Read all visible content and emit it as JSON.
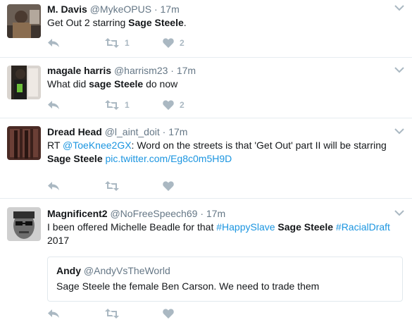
{
  "tweets": [
    {
      "name": "M. Davis",
      "handle": "@MykeOPUS",
      "separator": "·",
      "time": "17m",
      "text_1": "Get Out 2 starring ",
      "text_bold_1": "Sage Steele",
      "text_2": ".",
      "retweets": "1",
      "likes": "2"
    },
    {
      "name": "magale harris",
      "handle": "@harrism23",
      "separator": "·",
      "time": "17m",
      "text_1": "What did ",
      "text_bold_1": "sage Steele",
      "text_2": " do now",
      "retweets": "1",
      "likes": "2"
    },
    {
      "name": "Dread Head",
      "handle": "@l_aint_doit",
      "separator": "·",
      "time": "17m",
      "text_1": "RT ",
      "mention": "@ToeKnee2GX",
      "text_2": ": Word on the streets is that 'Get Out' part II will be starring",
      "text_bold_1": "Sage Steele",
      "link": "pic.twitter.com/Eg8c0m5H9D"
    },
    {
      "name": "Magnificent2",
      "handle": "@NoFreeSpeech69",
      "separator": "·",
      "time": "17m",
      "text_1": "I been offered Michelle Beadle for that ",
      "hashtag_1": "#HappySlave",
      "text_bold_1": "Sage Steele",
      "hashtag_2": "#RacialDraft",
      "text_2": "2017",
      "quote": {
        "name": "Andy",
        "handle": "@AndyVsTheWorld",
        "text": "Sage Steele the female Ben Carson. We need to trade them"
      }
    }
  ],
  "icons": {
    "reply": "reply-icon",
    "retweet": "retweet-icon",
    "like": "heart-icon",
    "menu": "chevron-down-icon"
  },
  "colors": {
    "text": "#14171a",
    "muted": "#657786",
    "link": "#1b95e0",
    "action": "#aab8c2",
    "divider": "#e6ecf0"
  }
}
